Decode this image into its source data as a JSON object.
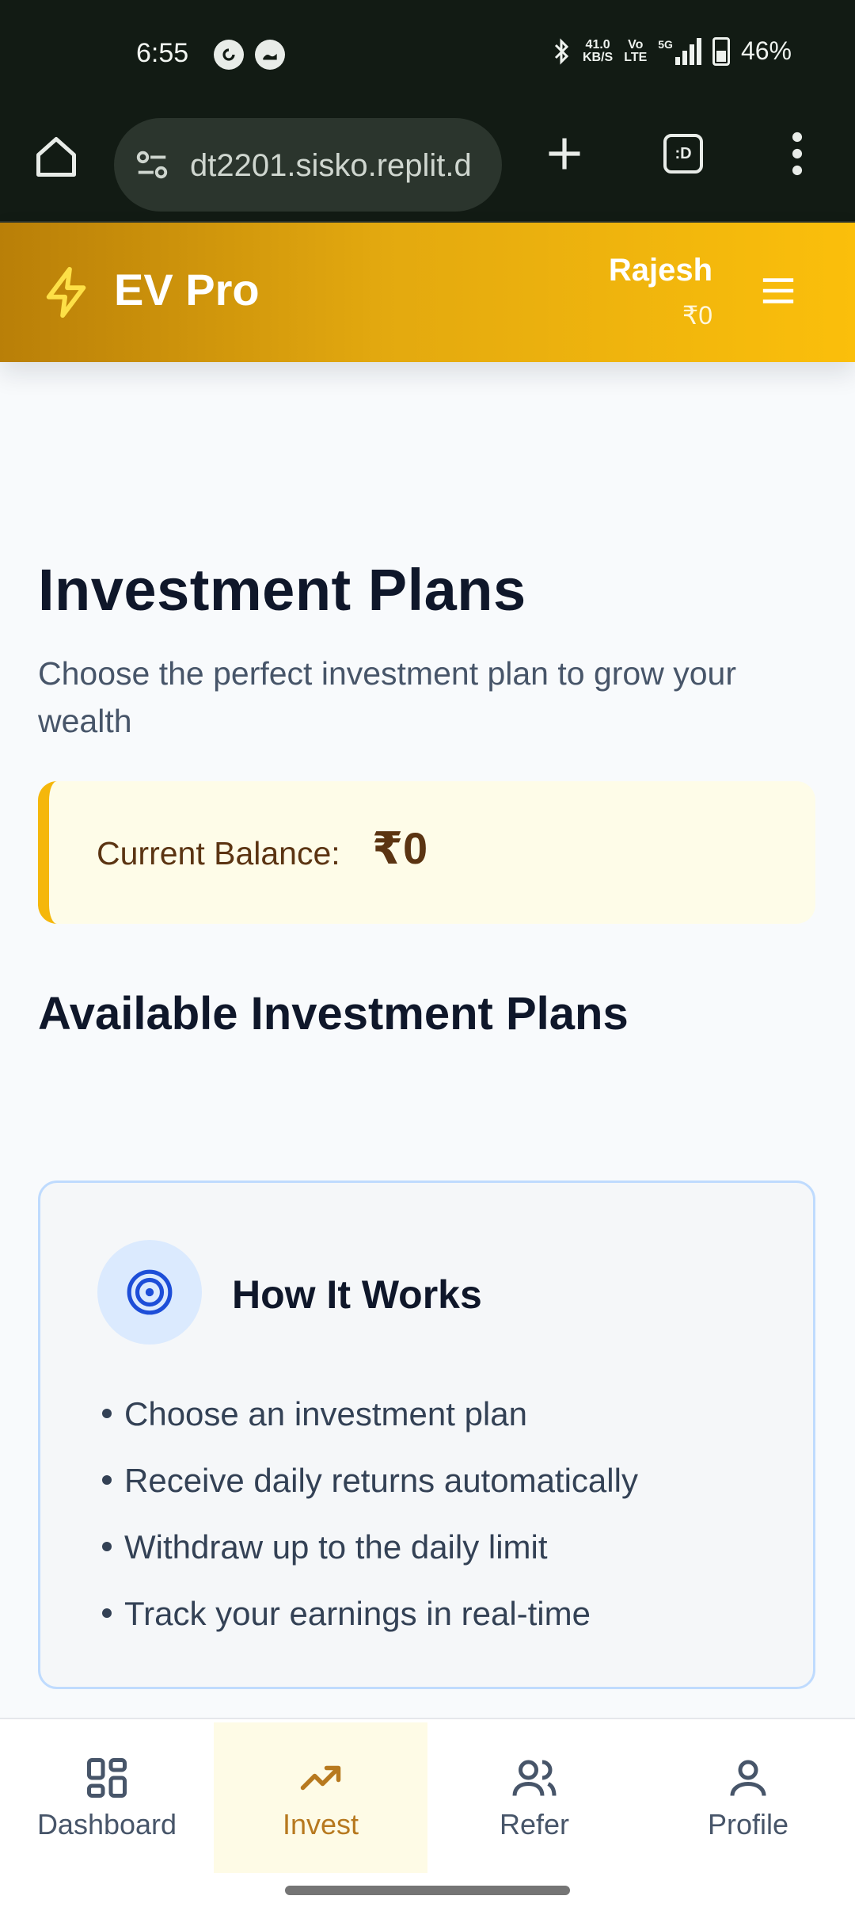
{
  "status_bar": {
    "time": "6:55",
    "net_speed_value": "41.0",
    "net_speed_unit": "KB/S",
    "volte_top": "Vo",
    "volte_bottom": "LTE",
    "network": "5G",
    "battery": "46%"
  },
  "browser": {
    "url": "dt2201.sisko.replit.d",
    "tabs_label": ":D"
  },
  "header": {
    "brand": "EV Pro",
    "user_name": "Rajesh",
    "user_balance": "₹0"
  },
  "main": {
    "title": "Investment Plans",
    "subtitle": "Choose the perfect investment plan to grow your wealth",
    "balance_label": "Current Balance:",
    "balance_value": "₹0",
    "section_title": "Available Investment Plans"
  },
  "how_it_works": {
    "title": "How It Works",
    "items": [
      "Choose an investment plan",
      "Receive daily returns automatically",
      "Withdraw up to the daily limit",
      "Track your earnings in real-time"
    ]
  },
  "bottom_nav": {
    "items": [
      {
        "label": "Dashboard",
        "icon": "dashboard-icon"
      },
      {
        "label": "Invest",
        "icon": "trending-up-icon",
        "active": true
      },
      {
        "label": "Refer",
        "icon": "users-icon"
      },
      {
        "label": "Profile",
        "icon": "user-icon"
      }
    ]
  },
  "colors": {
    "accent": "#f5b70b",
    "header_start": "#b97f08",
    "header_end": "#fbbf0b",
    "active_nav": "#b7791f",
    "info_border": "#bfdbfe"
  }
}
